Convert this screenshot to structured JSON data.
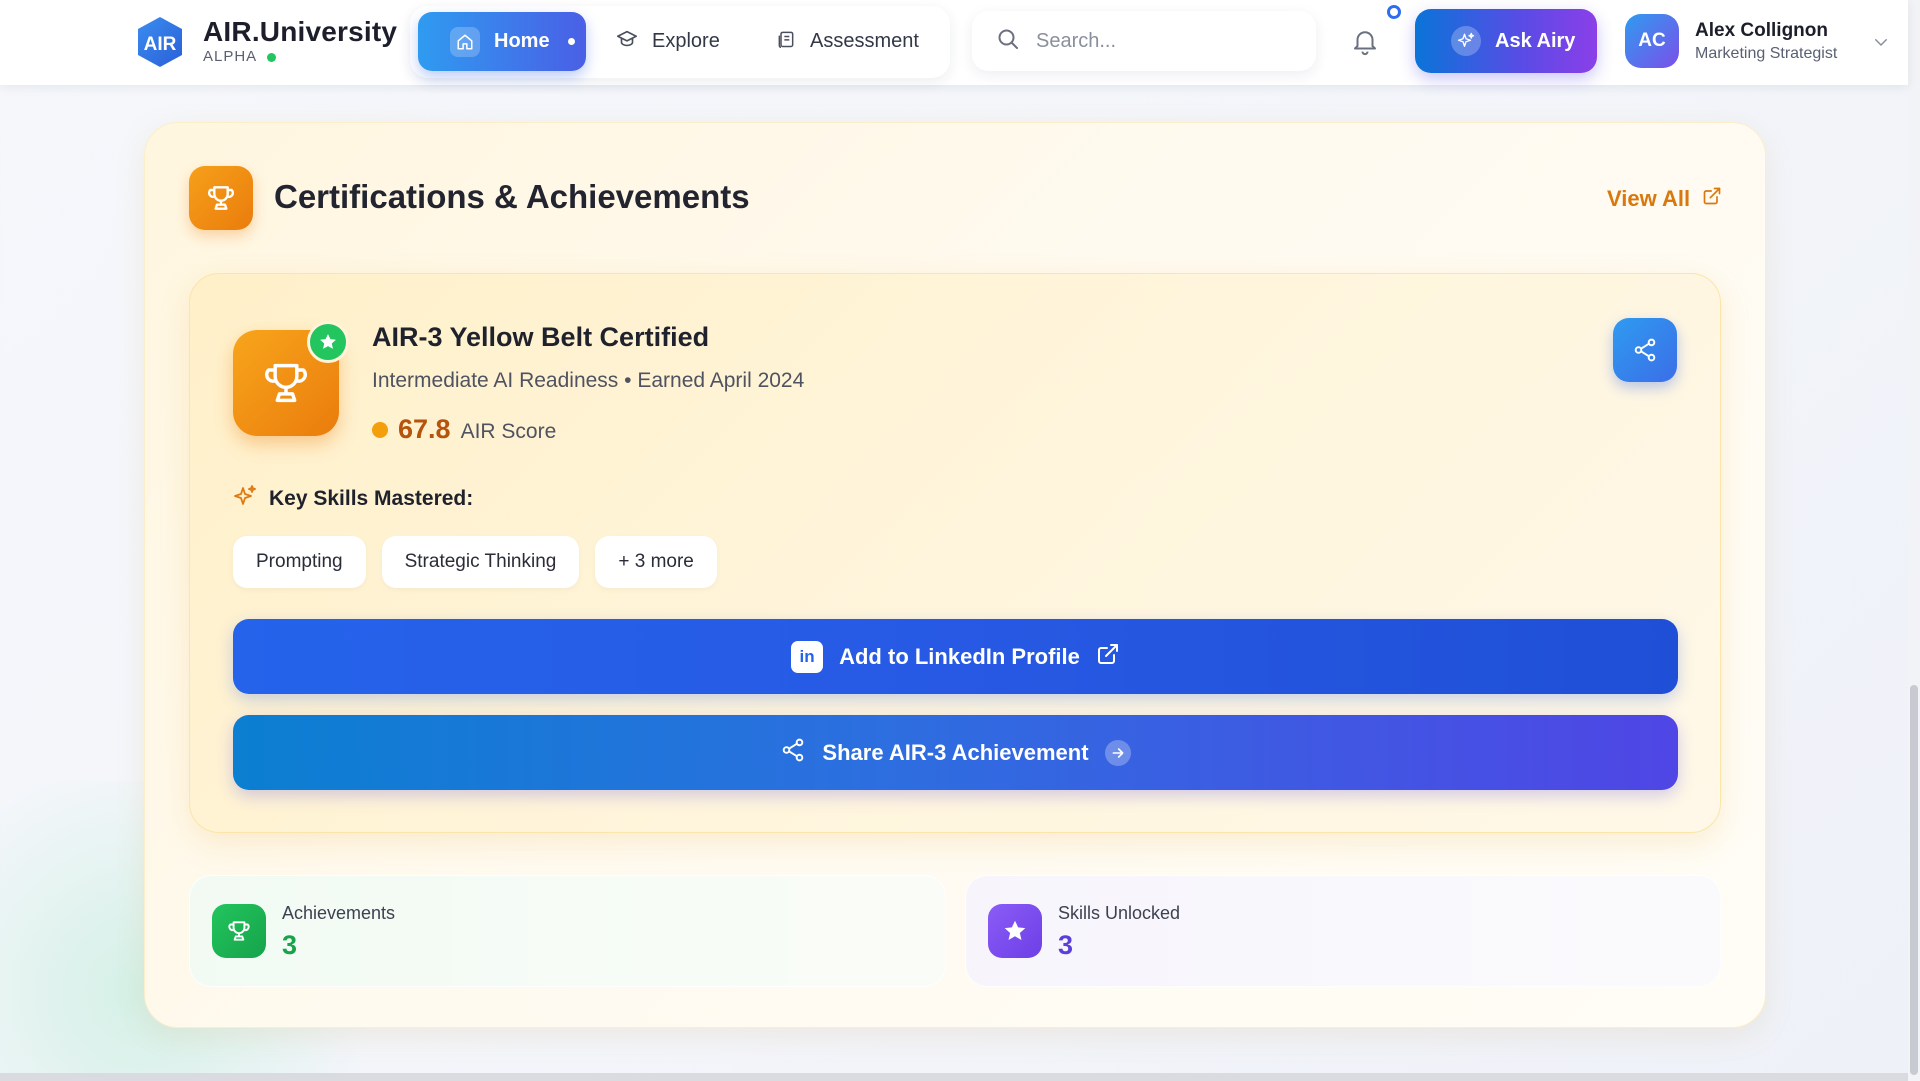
{
  "header": {
    "logo_text": "AIR",
    "brand_name": "AIR.University",
    "brand_tag": "ALPHA",
    "nav": {
      "home": "Home",
      "explore": "Explore",
      "assessment": "Assessment"
    },
    "search_placeholder": "Search...",
    "ask_button": "Ask Airy",
    "user": {
      "initials": "AC",
      "name": "Alex Collignon",
      "role": "Marketing Strategist"
    }
  },
  "section": {
    "title": "Certifications & Achievements",
    "view_all": "View All"
  },
  "certificate": {
    "title": "AIR-3 Yellow Belt Certified",
    "subtitle": "Intermediate AI Readiness • Earned April 2024",
    "score": "67.8",
    "score_label": "AIR Score",
    "skills_heading": "Key Skills Mastered:",
    "skills": [
      "Prompting",
      "Strategic Thinking",
      "+ 3 more"
    ],
    "linkedin_badge": "in",
    "linkedin_button": "Add to LinkedIn Profile",
    "share_button": "Share AIR-3 Achievement"
  },
  "stats": [
    {
      "label": "Achievements",
      "value": "3"
    },
    {
      "label": "Skills Unlocked",
      "value": "3"
    }
  ],
  "colors": {
    "accent_blue": "#2563eb",
    "accent_orange": "#ea7c0c",
    "success_green": "#22c55e",
    "purple": "#6d3fe6"
  }
}
